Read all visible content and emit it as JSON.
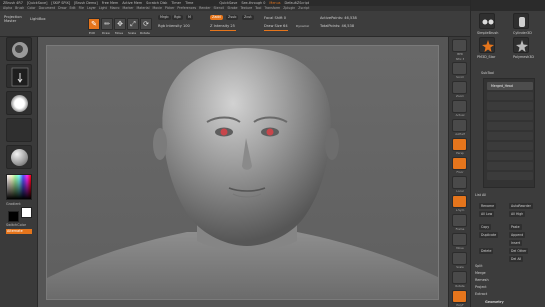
{
  "titlebar": {
    "app": "ZBrush 4R7",
    "items": [
      "[QuickSave]",
      "[SKIP SPIX]",
      "[Brush Demo]",
      "Free Mem",
      "Active Mem",
      "Scratch Disk",
      "Timer",
      "Time"
    ],
    "quicksave": "QuickSave",
    "see_through": "See-through 0",
    "menus": "Menus",
    "default_script": "DefaultZScript"
  },
  "menubar": [
    "Alpha",
    "Brush",
    "Color",
    "Document",
    "Draw",
    "Edit",
    "File",
    "Layer",
    "Light",
    "Macro",
    "Marker",
    "Material",
    "Movie",
    "Picker",
    "Preferences",
    "Render",
    "Stencil",
    "Stroke",
    "Texture",
    "Tool",
    "Transform",
    "Zplugin",
    "Zscript"
  ],
  "toolbar": {
    "projection_master": "Projection Master",
    "lightbox": "LightBox",
    "edit": "Edit",
    "draw": "Draw",
    "move": "Move",
    "scale": "Scale",
    "rotate": "Rotate",
    "mrgb": "Mrgb",
    "rgb": "Rgb",
    "m": "M",
    "zadd": "Zadd",
    "zsub": "Zsub",
    "zcut": "Zcut",
    "rgb_intensity": "Rgb Intensity 100",
    "z_intensity": "Z Intensity 25",
    "focal_shift": "Focal Shift 0",
    "draw_size": "Draw Size 64",
    "dynamic": "Dynamic",
    "active_points": "ActivePoints: 46,538",
    "total_points": "TotalPoints: 46,538"
  },
  "left_shelf": {
    "brush_label": "ClayBuildup",
    "stroke_label": "DragRect",
    "alpha_label": "Alpha Off",
    "texture_label": "Texture Off",
    "material_label": "MatCap Gray",
    "gradient_label": "Gradient",
    "switch_color": "SwitchColor",
    "alternate": "Alternate"
  },
  "right_nav": [
    "BPR",
    "SPix 3",
    "Scroll",
    "Zoom",
    "Actual",
    "AAHalf",
    "Persp",
    "Floor",
    "Local",
    "L.Sym",
    "Frame",
    "Move",
    "Scale",
    "Rotate",
    "PolyF",
    "Transp",
    "Ghost",
    "Solo",
    "Xpose"
  ],
  "tray": {
    "tool_title": "SimpleBrush",
    "eraser": "EraserBrush",
    "tools": [
      "SimpleBrush",
      "Cylinder3D",
      "PM3D_Star",
      "Polymesh3D"
    ],
    "subtool": "SubTool",
    "subtool_name": "Merged_Head",
    "list_all": "List All",
    "buttons": [
      "Rename",
      "AutoReorder",
      "All Low",
      "All High",
      "Copy",
      "Paste",
      "Duplicate",
      "Append",
      "Insert",
      "Delete",
      "Del Other",
      "Del All",
      "Split",
      "Merge",
      "Remesh",
      "Project",
      "Extract",
      "Geometry"
    ]
  },
  "colors": {
    "accent": "#e5751c",
    "panel": "#3c3c3c",
    "canvas": "#5f5f5f",
    "eye": "#c8464b"
  }
}
